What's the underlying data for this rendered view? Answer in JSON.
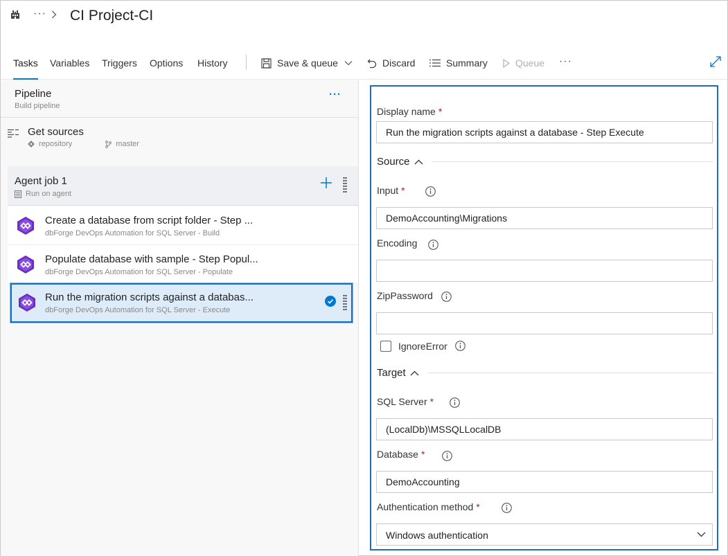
{
  "header": {
    "breadcrumb_more": "···",
    "title": "CI Project-CI"
  },
  "toolbar": {
    "tabs": [
      {
        "label": "Tasks",
        "active": true
      },
      {
        "label": "Variables"
      },
      {
        "label": "Triggers"
      },
      {
        "label": "Options"
      },
      {
        "label": "History"
      }
    ],
    "save_queue": "Save & queue",
    "discard": "Discard",
    "summary": "Summary",
    "queue": "Queue",
    "more": "···"
  },
  "pipeline": {
    "title": "Pipeline",
    "subtitle": "Build pipeline",
    "more": "···"
  },
  "get_sources": {
    "title": "Get sources",
    "repo": "repository",
    "branch": "master"
  },
  "agent_job": {
    "title": "Agent job 1",
    "subtitle": "Run on agent"
  },
  "tasks": [
    {
      "title": "Create a database from script folder - Step ...",
      "subtitle": "dbForge DevOps Automation for SQL Server - Build"
    },
    {
      "title": "Populate database with sample - Step Popul...",
      "subtitle": "dbForge DevOps Automation for SQL Server - Populate"
    },
    {
      "title": "Run the migration scripts against a databas...",
      "subtitle": "dbForge DevOps Automation for SQL Server - Execute",
      "selected": true
    }
  ],
  "form": {
    "display_name_label": "Display name",
    "display_name_value": "Run the migration scripts against a database - Step Execute",
    "source_section": "Source",
    "input_label": "Input",
    "input_value": "DemoAccounting\\Migrations",
    "encoding_label": "Encoding",
    "encoding_value": "",
    "zip_password_label": "ZipPassword",
    "zip_password_value": "",
    "ignore_error_label": "IgnoreError",
    "ignore_error_checked": false,
    "target_section": "Target",
    "sql_server_label": "SQL Server",
    "sql_server_value": "(LocalDb)\\MSSQLLocalDB",
    "database_label": "Database",
    "database_value": "DemoAccounting",
    "auth_label": "Authentication method",
    "auth_value": "Windows authentication",
    "required_mark": "*"
  },
  "colors": {
    "accent": "#0078d4",
    "selection_border": "#1f6fb8",
    "selection_bg": "#deecf9",
    "required": "#a4262c",
    "task_icon": "#6b2fbf"
  },
  "icons": [
    "org-icon",
    "chevron-right-icon",
    "save-icon",
    "chevron-down-icon",
    "undo-icon",
    "list-icon",
    "play-icon",
    "expand-icon",
    "get-sources-icon",
    "repo-icon",
    "branch-icon",
    "agent-icon",
    "plus-icon",
    "grip-icon",
    "dbforge-task-icon",
    "check-circle-icon",
    "info-icon",
    "chevron-up-icon"
  ]
}
